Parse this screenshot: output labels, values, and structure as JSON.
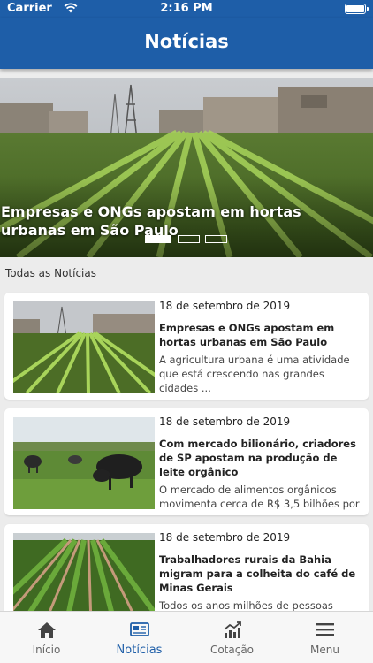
{
  "status_bar": {
    "carrier": "Carrier",
    "time": "2:16 PM",
    "wifi_icon": "wifi-icon",
    "battery_icon": "battery-icon"
  },
  "header": {
    "title": "Notícias"
  },
  "hero": {
    "title": "Empresas e ONGs apostam em hortas urbanas em São Paulo",
    "slides_count": 3,
    "active_slide": 1
  },
  "section": {
    "label": "Todas as Notícias"
  },
  "news": [
    {
      "date": "18 de setembro de 2019",
      "title": "Empresas e ONGs apostam em hortas urbanas em São Paulo",
      "summary": "A agricultura urbana é uma atividade que está crescendo nas grandes cidades ..."
    },
    {
      "date": "18 de setembro de 2019",
      "title": "Com mercado bilionário, criadores de SP apostam na produção de leite orgânico",
      "summary": "O mercado de alimentos orgânicos movimenta cerca de R$ 3,5 bilhões por ..."
    },
    {
      "date": "18 de setembro de 2019",
      "title": "Trabalhadores rurais da Bahia migram para a colheita do café de Minas Gerais",
      "summary": "Todos os anos milhões de pessoas"
    }
  ],
  "tabs": [
    {
      "label": "Início",
      "icon": "home-icon"
    },
    {
      "label": "Notícias",
      "icon": "newspaper-icon"
    },
    {
      "label": "Cotação",
      "icon": "chart-icon"
    },
    {
      "label": "Menu",
      "icon": "menu-icon"
    }
  ],
  "colors": {
    "primary": "#1e5ea8",
    "background": "#ececec",
    "tab_active": "#1e5ea8",
    "tab_inactive": "#666666"
  }
}
